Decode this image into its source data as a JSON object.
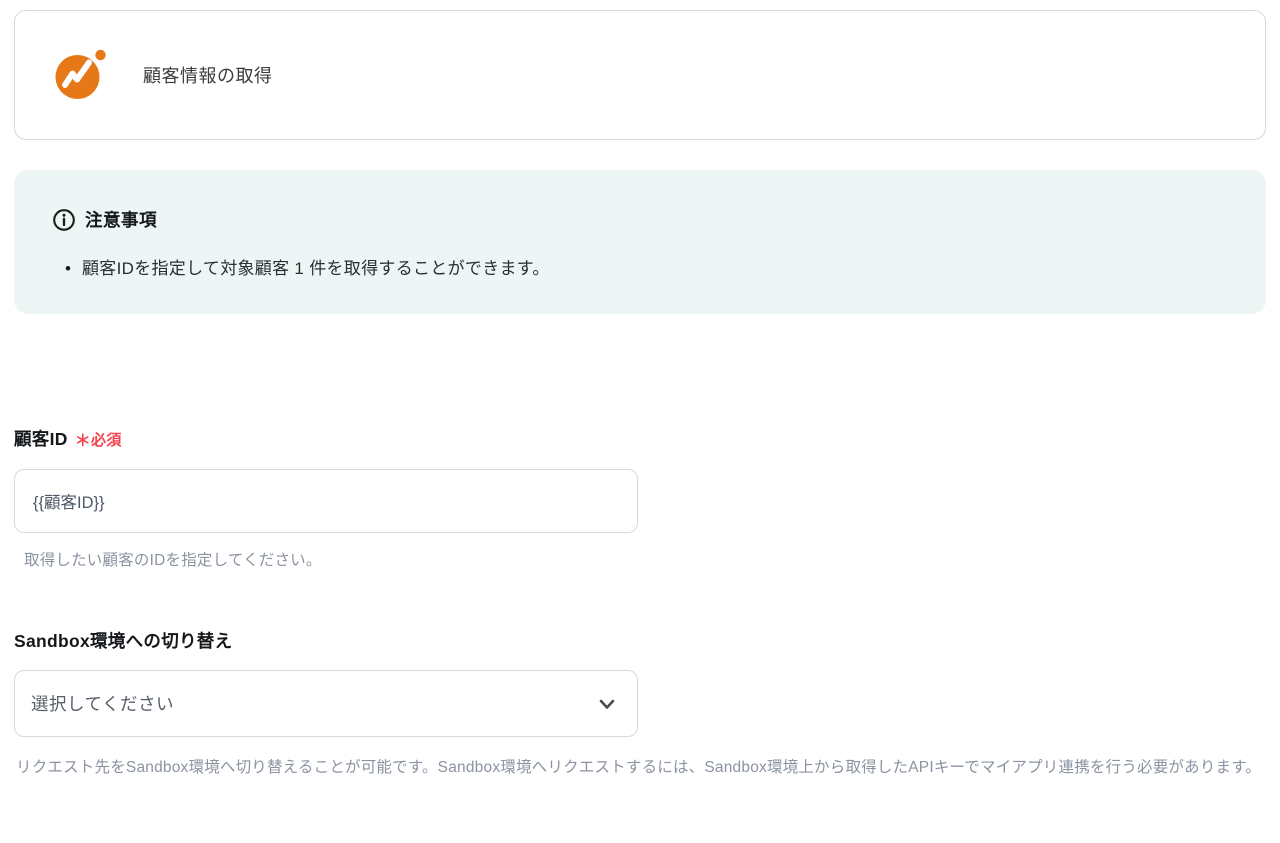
{
  "header": {
    "title": "顧客情報の取得",
    "logo_icon": "money-forward-logo"
  },
  "notice": {
    "icon": "info-icon",
    "heading": "注意事項",
    "items": [
      "顧客IDを指定して対象顧客 1 件を取得することができます。"
    ]
  },
  "form": {
    "customer_id": {
      "label": "顧客ID",
      "required_mark": "＊",
      "required_text": "必須",
      "value": "{{顧客ID}}",
      "helper": "取得したい顧客のIDを指定してください。"
    },
    "sandbox": {
      "label": "Sandbox環境への切り替え",
      "selected_value": "選択してください",
      "dropdown_icon": "chevron-down-icon",
      "helper": "リクエスト先をSandbox環境へ切り替えることが可能です。Sandbox環境へリクエストするには、Sandbox環境上から取得したAPIキーでマイアプリ連携を行う必要があります。"
    }
  },
  "colors": {
    "brand_orange": "#E67817",
    "notice_bg": "#EDF6F4",
    "required_red": "#F2434E",
    "border_gray": "#D9D9D9"
  }
}
